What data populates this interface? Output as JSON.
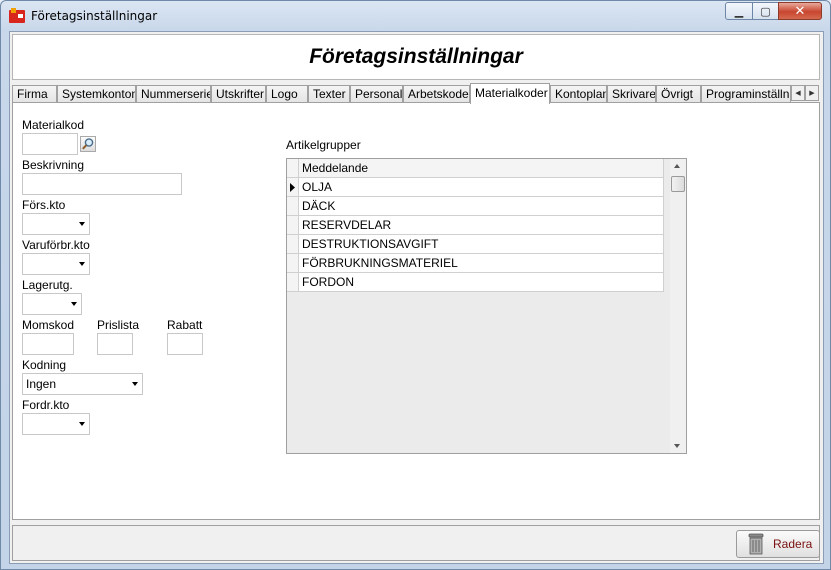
{
  "window": {
    "title": "Företagsinställningar"
  },
  "header": {
    "title": "Företagsinställningar"
  },
  "tabs": [
    {
      "label": "Firma"
    },
    {
      "label": "Systemkonton"
    },
    {
      "label": "Nummerserier"
    },
    {
      "label": "Utskrifter"
    },
    {
      "label": "Logo"
    },
    {
      "label": "Texter"
    },
    {
      "label": "Personal"
    },
    {
      "label": "Arbetskoder"
    },
    {
      "label": "Materialkoder",
      "active": true
    },
    {
      "label": "Kontoplan"
    },
    {
      "label": "Skrivare"
    },
    {
      "label": "Övrigt"
    },
    {
      "label": "Programinställningar"
    }
  ],
  "form": {
    "materialkod_label": "Materialkod",
    "materialkod_value": "",
    "beskrivning_label": "Beskrivning",
    "beskrivning_value": "",
    "fors_kto_label": "Förs.kto",
    "fors_kto_value": "",
    "varuforbr_kto_label": "Varuförbr.kto",
    "varuforbr_kto_value": "",
    "lagerutg_label": "Lagerutg.",
    "lagerutg_value": "",
    "momskod_label": "Momskod",
    "prislista_label": "Prislista",
    "rabatt_label": "Rabatt",
    "kodning_label": "Kodning",
    "kodning_value": "Ingen",
    "fordr_kto_label": "Fordr.kto",
    "fordr_kto_value": ""
  },
  "artikelgrupper": {
    "label": "Artikelgrupper",
    "column_header": "Meddelande",
    "rows": [
      "OLJA",
      "DÄCK",
      "RESERVDELAR",
      "DESTRUKTIONSAVGIFT",
      "FÖRBRUKNINGSMATERIEL",
      "FORDON"
    ]
  },
  "footer": {
    "delete_label": "Radera"
  },
  "colors": {
    "accent_red": "#c8452f",
    "delete_text": "#7a1010"
  }
}
